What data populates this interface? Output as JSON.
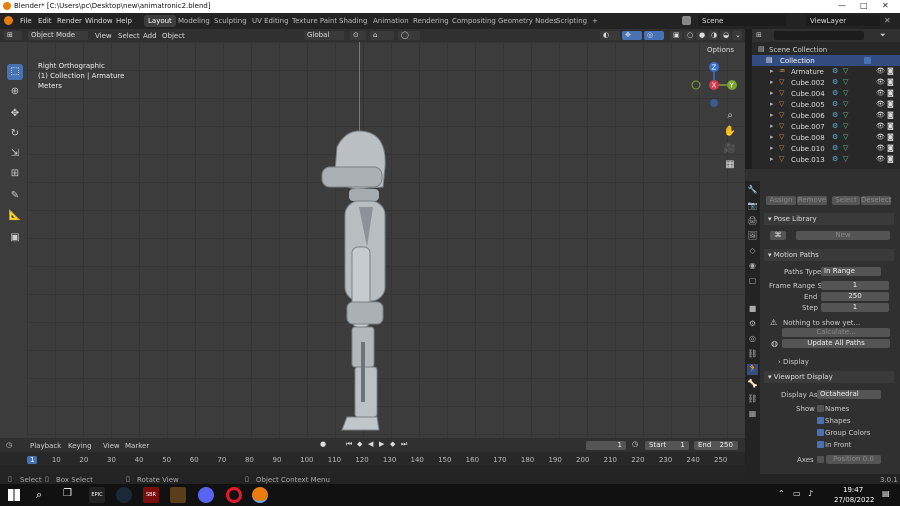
{
  "titlebar": {
    "title": "Blender* [C:\\Users\\pc\\Desktop\\new\\animatronic2.blend]",
    "min": "—",
    "max": "□",
    "close": "✕"
  },
  "menu": [
    "File",
    "Edit",
    "Render",
    "Window",
    "Help"
  ],
  "workspaces": [
    "Layout",
    "Modeling",
    "Sculpting",
    "UV Editing",
    "Texture Paint",
    "Shading",
    "Animation",
    "Rendering",
    "Compositing",
    "Geometry Nodes",
    "Scripting"
  ],
  "add_workspace": "+",
  "scene": "Scene",
  "view_layer": "ViewLayer",
  "viewport_header": {
    "mode": "Object Mode",
    "menus": [
      "View",
      "Select",
      "Add",
      "Object"
    ],
    "orientation": "Global",
    "options": "Options"
  },
  "viewport_overlay": {
    "view": "Right Orthographic",
    "collection": "(1) Collection | Armature",
    "units": "Meters"
  },
  "gizmo": {
    "z": "Z",
    "y": "Y",
    "x": "X"
  },
  "outliner": {
    "root": "Scene Collection",
    "collection": "Collection",
    "items": [
      "Armature",
      "Cube.002",
      "Cube.004",
      "Cube.005",
      "Cube.006",
      "Cube.007",
      "Cube.008",
      "Cube.010",
      "Cube.013"
    ]
  },
  "properties": {
    "buttons": [
      "Assign",
      "Remove",
      "Select",
      "Deselect"
    ],
    "pose_library": "Pose Library",
    "new": "New",
    "motion_paths": "Motion Paths",
    "paths_type_label": "Paths Type",
    "paths_type": "In Range",
    "frame_range_label": "Frame Range S...",
    "frame_start": "1",
    "end_label": "End",
    "frame_end": "250",
    "step_label": "Step",
    "step": "1",
    "nothing": "Nothing to show yet...",
    "calculate": "Calculate...",
    "update_all": "Update All Paths",
    "display": "Display",
    "viewport_display": "Viewport Display",
    "display_as_label": "Display As",
    "display_as": "Octahedral",
    "show_label": "Show",
    "names": "Names",
    "shapes": "Shapes",
    "group_colors": "Group Colors",
    "in_front": "In Front",
    "axes_label": "Axes",
    "position": "Position",
    "position_value": "0.0"
  },
  "timeline": {
    "menus": [
      "Playback",
      "Keying",
      "View",
      "Marker"
    ],
    "current": "1",
    "start_label": "Start",
    "start": "1",
    "end_label": "End",
    "end": "250",
    "ticks": [
      "1",
      "10",
      "20",
      "30",
      "40",
      "50",
      "60",
      "70",
      "80",
      "90",
      "100",
      "110",
      "120",
      "130",
      "140",
      "150",
      "160",
      "170",
      "180",
      "190",
      "200",
      "210",
      "220",
      "230",
      "240",
      "250"
    ]
  },
  "status": {
    "select": "Select",
    "box_select": "Box Select",
    "rotate": "Rotate View",
    "context": "Object Context Menu",
    "version": "3.0.1"
  },
  "taskbar": {
    "time": "19:47",
    "date": "27/08/2022",
    "epic": "EPIC",
    "sbr": "SBR"
  }
}
